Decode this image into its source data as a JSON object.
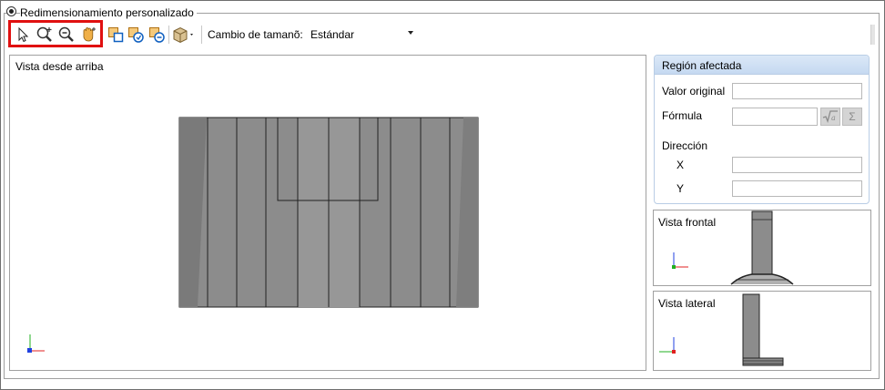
{
  "section": {
    "radio_label": "Redimensionamiento personalizado",
    "selected": true
  },
  "toolbar": {
    "tools": [
      {
        "name": "select-tool",
        "icon": "cursor-arrow-icon"
      },
      {
        "name": "zoom-in-tool",
        "icon": "zoom-in-icon"
      },
      {
        "name": "zoom-out-tool",
        "icon": "zoom-out-icon"
      },
      {
        "name": "pan-tool",
        "icon": "hand-pan-icon"
      }
    ],
    "resize_label": "Cambio de tamanõ:",
    "resize_value": "Estándar"
  },
  "top_view": {
    "title": "Vista desde arriba"
  },
  "region_panel": {
    "title": "Región afectada",
    "original_value_label": "Valor original",
    "original_value": "",
    "formula_label": "Fórmula",
    "formula_value": "",
    "direction_label": "Dirección",
    "x_label": "X",
    "x_value": "",
    "y_label": "Y",
    "y_value": "",
    "sqrt_icon": "sqrt-formula-icon",
    "sum_icon": "sigma-sum-icon",
    "sum_glyph": "Σ"
  },
  "front_view": {
    "title": "Vista frontal"
  },
  "side_view": {
    "title": "Vista lateral"
  },
  "colors": {
    "highlight": "#e01010",
    "panel_header": "#c5d9f1",
    "model_gray": "#8c8c8c",
    "axis_x": "#e02020",
    "axis_y": "#20b020",
    "axis_z": "#2040e0"
  }
}
